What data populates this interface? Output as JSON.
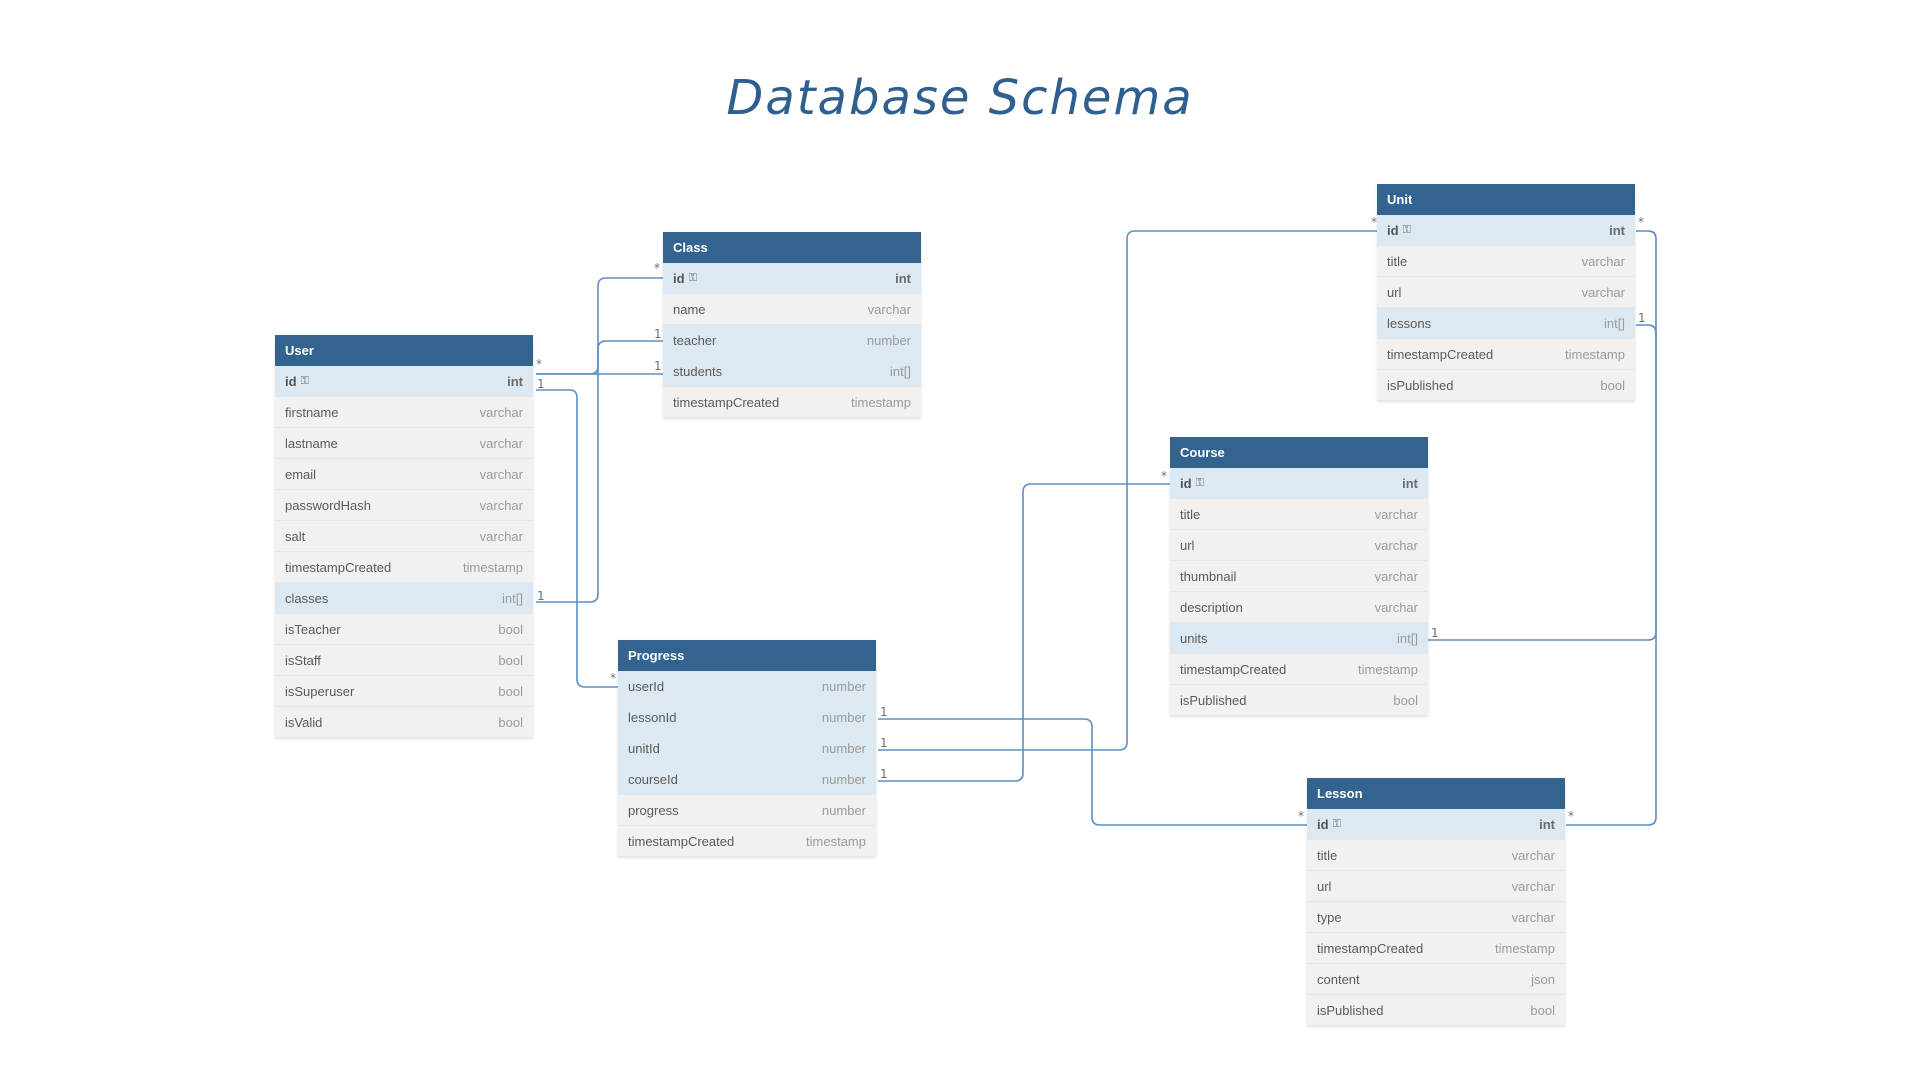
{
  "title": "Database Schema",
  "colors": {
    "header": "#33648f",
    "connector": "#5b8fc0",
    "title": "#2f5f8f"
  },
  "tables": {
    "user": {
      "name": "User",
      "fields": [
        {
          "name": "id",
          "type": "int",
          "pk": true
        },
        {
          "name": "firstname",
          "type": "varchar"
        },
        {
          "name": "lastname",
          "type": "varchar"
        },
        {
          "name": "email",
          "type": "varchar"
        },
        {
          "name": "passwordHash",
          "type": "varchar"
        },
        {
          "name": "salt",
          "type": "varchar"
        },
        {
          "name": "timestampCreated",
          "type": "timestamp"
        },
        {
          "name": "classes",
          "type": "int[]",
          "hl": true
        },
        {
          "name": "isTeacher",
          "type": "bool"
        },
        {
          "name": "isStaff",
          "type": "bool"
        },
        {
          "name": "isSuperuser",
          "type": "bool"
        },
        {
          "name": "isValid",
          "type": "bool"
        }
      ]
    },
    "class": {
      "name": "Class",
      "fields": [
        {
          "name": "id",
          "type": "int",
          "pk": true
        },
        {
          "name": "name",
          "type": "varchar"
        },
        {
          "name": "teacher",
          "type": "number",
          "hl": true
        },
        {
          "name": "students",
          "type": "int[]",
          "hl": true
        },
        {
          "name": "timestampCreated",
          "type": "timestamp"
        }
      ]
    },
    "progress": {
      "name": "Progress",
      "fields": [
        {
          "name": "userId",
          "type": "number",
          "hl": true
        },
        {
          "name": "lessonId",
          "type": "number",
          "hl": true
        },
        {
          "name": "unitId",
          "type": "number",
          "hl": true
        },
        {
          "name": "courseId",
          "type": "number",
          "hl": true
        },
        {
          "name": "progress",
          "type": "number"
        },
        {
          "name": "timestampCreated",
          "type": "timestamp"
        }
      ]
    },
    "unit": {
      "name": "Unit",
      "fields": [
        {
          "name": "id",
          "type": "int",
          "pk": true
        },
        {
          "name": "title",
          "type": "varchar"
        },
        {
          "name": "url",
          "type": "varchar"
        },
        {
          "name": "lessons",
          "type": "int[]",
          "hl": true
        },
        {
          "name": "timestampCreated",
          "type": "timestamp"
        },
        {
          "name": "isPublished",
          "type": "bool"
        }
      ]
    },
    "course": {
      "name": "Course",
      "fields": [
        {
          "name": "id",
          "type": "int",
          "pk": true
        },
        {
          "name": "title",
          "type": "varchar"
        },
        {
          "name": "url",
          "type": "varchar"
        },
        {
          "name": "thumbnail",
          "type": "varchar"
        },
        {
          "name": "description",
          "type": "varchar"
        },
        {
          "name": "units",
          "type": "int[]",
          "hl": true
        },
        {
          "name": "timestampCreated",
          "type": "timestamp"
        },
        {
          "name": "isPublished",
          "type": "bool"
        }
      ]
    },
    "lesson": {
      "name": "Lesson",
      "fields": [
        {
          "name": "id",
          "type": "int",
          "pk": true
        },
        {
          "name": "title",
          "type": "varchar"
        },
        {
          "name": "url",
          "type": "varchar"
        },
        {
          "name": "type",
          "type": "varchar"
        },
        {
          "name": "timestampCreated",
          "type": "timestamp"
        },
        {
          "name": "content",
          "type": "json"
        },
        {
          "name": "isPublished",
          "type": "bool"
        }
      ]
    }
  },
  "relations": [
    {
      "from": "User.id",
      "to": "Class.teacher",
      "from_card": "*",
      "to_card": "1"
    },
    {
      "from": "User.id",
      "to": "Class.students",
      "from_card": "*",
      "to_card": "1"
    },
    {
      "from": "User.classes",
      "to": "Class.id",
      "from_card": "1",
      "to_card": "*"
    },
    {
      "from": "User.id",
      "to": "Progress.userId",
      "from_card": "1",
      "to_card": "*"
    },
    {
      "from": "Progress.lessonId",
      "to": "Lesson.id",
      "from_card": "1",
      "to_card": "*"
    },
    {
      "from": "Progress.unitId",
      "to": "Unit.id",
      "from_card": "1",
      "to_card": "*"
    },
    {
      "from": "Progress.courseId",
      "to": "Course.id",
      "from_card": "1",
      "to_card": "*"
    },
    {
      "from": "Course.units",
      "to": "Unit.id",
      "from_card": "1",
      "to_card": "*"
    },
    {
      "from": "Unit.lessons",
      "to": "Lesson.id",
      "from_card": "1",
      "to_card": "*"
    }
  ]
}
